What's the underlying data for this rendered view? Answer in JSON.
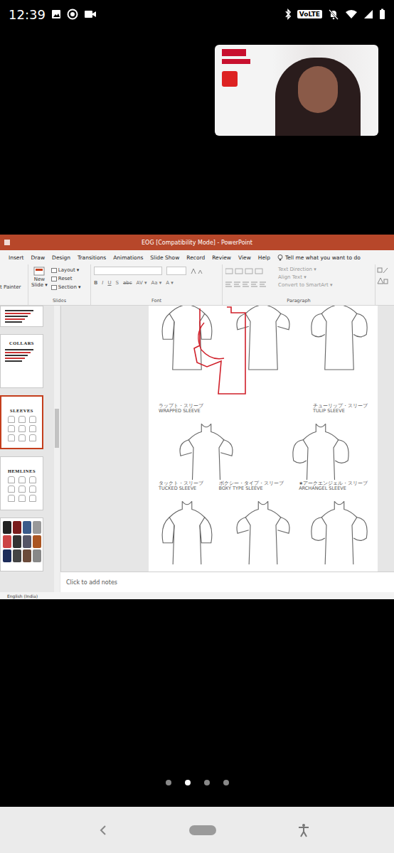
{
  "status_bar": {
    "time": "12:39",
    "volte": "VoLTE"
  },
  "app": {
    "title": "EOG [Compatibility Mode] - PowerPoint",
    "tabs": [
      {
        "label": "Insert",
        "selected": false
      },
      {
        "label": "Draw",
        "selected": false
      },
      {
        "label": "Design",
        "selected": false
      },
      {
        "label": "Transitions",
        "selected": false
      },
      {
        "label": "Animations",
        "selected": false
      },
      {
        "label": "Slide Show",
        "selected": false
      },
      {
        "label": "Record",
        "selected": false
      },
      {
        "label": "Review",
        "selected": false
      },
      {
        "label": "View",
        "selected": false
      },
      {
        "label": "Help",
        "selected": false
      }
    ],
    "tell_me": "Tell me what you want to do",
    "ribbon": {
      "clipboard": "t Painter",
      "new_slide": [
        "New",
        "Slide ▾"
      ],
      "slide_items": [
        "Layout ▾",
        "Reset",
        "Section ▾"
      ],
      "font_buttons": [
        "B",
        "I",
        "U",
        "S",
        "abc",
        "AV ▾",
        "Aa ▾",
        "A ▾"
      ],
      "paragraph_items": [
        {
          "label": "Text Direction ▾",
          "disabled": true
        },
        {
          "label": "Align Text ▾",
          "disabled": true
        },
        {
          "label": "Convert to SmartArt ▾",
          "disabled": true
        }
      ],
      "groups": [
        "Slides",
        "Font",
        "Paragraph"
      ]
    },
    "thumbnails": [
      {
        "kind": "text",
        "selected": false
      },
      {
        "kind": "text",
        "heading": "COLLARS",
        "selected": false
      },
      {
        "kind": "sketch",
        "heading": "SLEEVES",
        "selected": true
      },
      {
        "kind": "sketch",
        "heading": "HEMLINES",
        "selected": false
      },
      {
        "kind": "photo",
        "selected": false
      }
    ],
    "slide": {
      "label_rows": [
        [
          {
            "ja": "ラップト・スリーブ",
            "en": "WRAPPED SLEEVE"
          },
          {
            "ja": "チューリップ・スリーブ",
            "en": "TULIP SLEEVE"
          }
        ],
        [
          {
            "ja": "タックト・スリーブ",
            "en": "TUCKED SLEEVE"
          },
          {
            "ja": "ボクシー・タイプ・スリーブ",
            "en": "BOXY TYPE SLEEVE"
          },
          {
            "ja": "★アークエンジェル・スリーブ",
            "en": "ARCHANGEL SLEEVE"
          }
        ]
      ]
    },
    "notes_placeholder": "Click to add notes",
    "language": "English (India)"
  },
  "pager": [
    {
      "selected": false
    },
    {
      "selected": true
    },
    {
      "selected": false
    },
    {
      "selected": false
    }
  ]
}
